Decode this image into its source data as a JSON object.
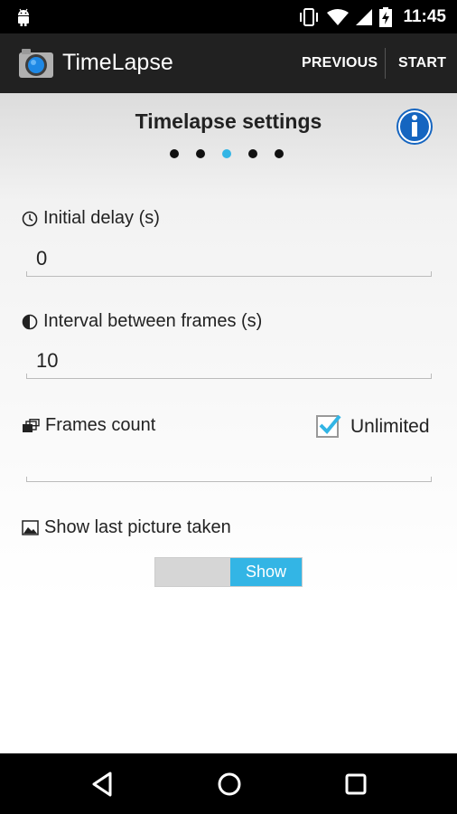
{
  "status_bar": {
    "time": "11:45",
    "icons": [
      "android-icon",
      "vibrate-icon",
      "wifi-icon",
      "signal-icon",
      "battery-charging-icon"
    ]
  },
  "action_bar": {
    "title": "TimeLapse",
    "previous_label": "PREVIOUS",
    "start_label": "START",
    "icons": [
      "camera-icon"
    ]
  },
  "main": {
    "title": "Timelapse settings",
    "info_icon": "info-icon",
    "page_dots": {
      "count": 5,
      "active_index": 2
    },
    "initial_delay": {
      "label": "Initial delay (s)",
      "value": "0",
      "icon": "clock-icon"
    },
    "interval": {
      "label": "Interval between frames (s)",
      "value": "10",
      "icon": "half-circle-icon"
    },
    "frames_count": {
      "label": "Frames count",
      "value": "",
      "icon": "frames-icon",
      "unlimited_label": "Unlimited",
      "unlimited_checked": true
    },
    "show_last_picture": {
      "label": "Show last picture taken",
      "icon": "picture-icon",
      "toggle_label": "Show",
      "toggle_on": true
    }
  },
  "nav_bar": {
    "icons": [
      "back-icon",
      "home-icon",
      "recents-icon"
    ]
  },
  "colors": {
    "accent": "#33b5e5",
    "action_bar": "#212121",
    "info_blue": "#1565c0"
  }
}
